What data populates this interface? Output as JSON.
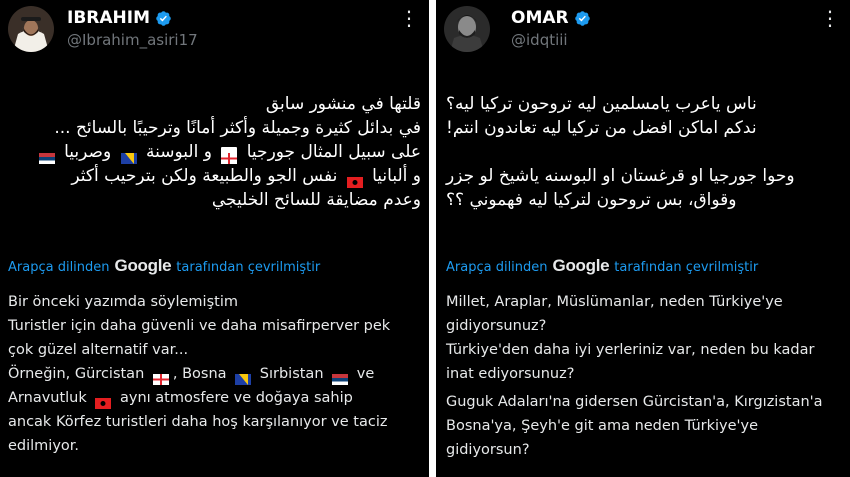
{
  "left": {
    "name": "IBRAHIM",
    "handle": "@Ibrahim_asiri17",
    "arabic": {
      "l1": "قلتها في منشور سابق",
      "l2": "في بدائل كثيرة وجميلة وأكثر أمانًا وترحيبًا بالسائح ...",
      "l3a": "على سبيل المثال جورجيا",
      "l3b": "و البوسنة",
      "l3c": "وصربيا",
      "l4a": "و ألبانيا",
      "l4b": "نفس الجو والطبيعة ولكن بترحيب أكثر",
      "l5": "وعدم مضايقة للسائح الخليجي"
    },
    "translate": {
      "prefix": "Arapça dilinden",
      "brand": "Google",
      "suffix": "tarafından çevrilmiştir"
    },
    "turkish": {
      "l1": "Bir önceki yazımda söylemiştim",
      "l2": "Turistler için daha güvenli ve daha misafirperver pek",
      "l3": "çok güzel alternatif var...",
      "l4a": "Örneğin, Gürcistan",
      "l4b": ", Bosna",
      "l4c": "Sırbistan",
      "l4d": "ve",
      "l5a": "Arnavutluk",
      "l5b": "aynı atmosfere ve doğaya sahip",
      "l6": "ancak Körfez turistleri daha hoş karşılanıyor ve taciz",
      "l7": "edilmiyor."
    }
  },
  "right": {
    "name": "OMAR",
    "handle": "@idqtiii",
    "arabic": {
      "l1": "ناس ياعرب يامسلمين ليه تروحون تركيا ليه؟",
      "l2": "ندكم اماكن افضل من تركيا ليه تعاندون انتم!",
      "l3": "وحوا جورجيا او قرغستان او البوسنه ياشيخ لو جزر",
      "l4": "وقواق، بس تروحون لتركيا ليه فهموني ؟؟"
    },
    "translate": {
      "prefix": "Arapça dilinden",
      "brand": "Google",
      "suffix": "tarafından çevrilmiştir"
    },
    "turkish": {
      "l1": "Millet, Araplar, Müslümanlar, neden Türkiye'ye",
      "l2": "gidiyorsunuz?",
      "l3": "Türkiye'den daha iyi yerleriniz var, neden bu kadar",
      "l4": "inat ediyorsunuz?",
      "l5": "Guguk Adaları'na gidersen Gürcistan'a, Kırgızistan'a",
      "l6": "Bosna'ya, Şeyh'e git ama neden Türkiye'ye",
      "l7": "gidiyorsun?"
    }
  },
  "icons": {
    "more": "⋮",
    "verified": "verified-badge-icon"
  },
  "colors": {
    "background": "#000000",
    "link": "#1d9bf0",
    "verified": "#1d9bf0",
    "muted": "#71767b"
  }
}
